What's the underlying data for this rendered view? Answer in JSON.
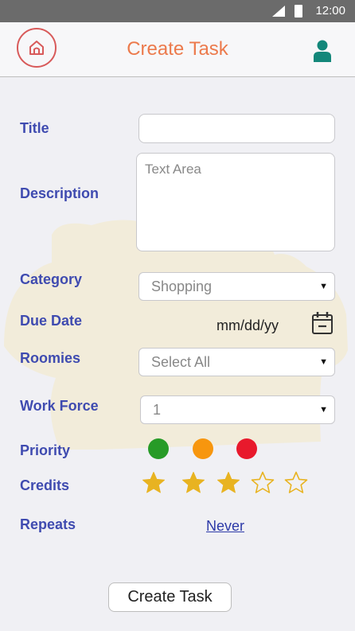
{
  "status_bar": {
    "time": "12:00"
  },
  "header": {
    "title": "Create Task"
  },
  "form": {
    "title_label": "Title",
    "title_value": "",
    "description_label": "Description",
    "description_placeholder": "Text Area",
    "category_label": "Category",
    "category_value": "Shopping",
    "due_date_label": "Due Date",
    "due_date_value": "mm/dd/yy",
    "roomies_label": "Roomies",
    "roomies_value": "Select All",
    "work_force_label": "Work Force",
    "work_force_value": "1",
    "priority_label": "Priority",
    "priority_colors": [
      "#279b27",
      "#f7960e",
      "#e8192c"
    ],
    "credits_label": "Credits",
    "credits": {
      "filled": 3,
      "total": 5
    },
    "repeats_label": "Repeats",
    "repeats_value": "Never"
  },
  "actions": {
    "create_label": "Create Task"
  },
  "colors": {
    "accent": "#ec7a4c",
    "label": "#3f4bb0",
    "star": "#e8b321",
    "logo": "#d85a5a",
    "user_icon": "#13877a"
  },
  "icons": {
    "logo": "house-logo-icon",
    "user": "user-icon",
    "calendar": "calendar-icon",
    "star_filled": "star-filled-icon",
    "star_empty": "star-outline-icon",
    "dropdown": "caret-down-icon"
  }
}
